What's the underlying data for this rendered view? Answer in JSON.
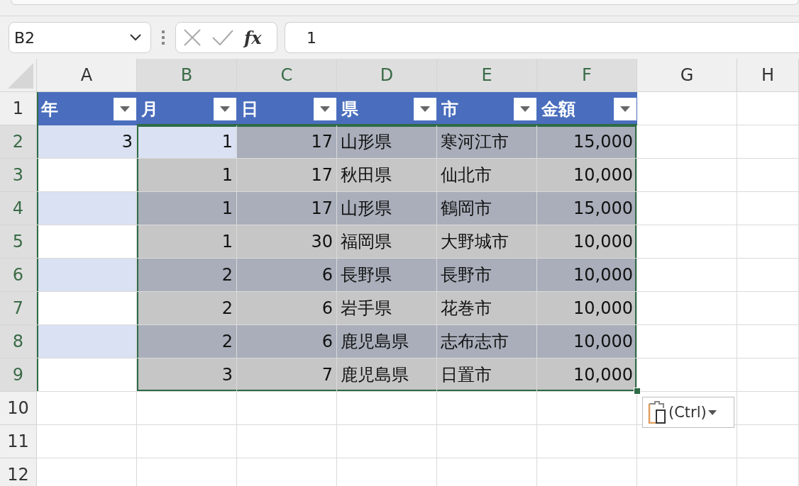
{
  "name_box": {
    "value": "B2"
  },
  "formula_bar": {
    "function_label": "fx",
    "value": "1"
  },
  "column_headers": [
    {
      "label": "A",
      "selected": false
    },
    {
      "label": "B",
      "selected": true
    },
    {
      "label": "C",
      "selected": true
    },
    {
      "label": "D",
      "selected": true
    },
    {
      "label": "E",
      "selected": true
    },
    {
      "label": "F",
      "selected": true
    },
    {
      "label": "G",
      "selected": false
    },
    {
      "label": "H",
      "selected": false
    }
  ],
  "row_headers": [
    {
      "label": "1",
      "selected": false
    },
    {
      "label": "2",
      "selected": true
    },
    {
      "label": "3",
      "selected": true
    },
    {
      "label": "4",
      "selected": true
    },
    {
      "label": "5",
      "selected": true
    },
    {
      "label": "6",
      "selected": true
    },
    {
      "label": "7",
      "selected": true
    },
    {
      "label": "8",
      "selected": true
    },
    {
      "label": "9",
      "selected": true
    },
    {
      "label": "10",
      "selected": false
    },
    {
      "label": "11",
      "selected": false
    },
    {
      "label": "12",
      "selected": false
    }
  ],
  "table": {
    "headers": [
      "年",
      "月",
      "日",
      "県",
      "市",
      "金額"
    ],
    "rows": [
      {
        "active": true,
        "year": "3",
        "month": "1",
        "day": "17",
        "prefecture": "山形県",
        "city": "寒河江市",
        "amount": "15,000"
      },
      {
        "active": false,
        "month": "1",
        "day": "17",
        "prefecture": "秋田県",
        "city": "仙北市",
        "amount": "10,000"
      },
      {
        "active": false,
        "month": "1",
        "day": "17",
        "prefecture": "山形県",
        "city": "鶴岡市",
        "amount": "15,000"
      },
      {
        "active": false,
        "month": "1",
        "day": "30",
        "prefecture": "福岡県",
        "city": "大野城市",
        "amount": "10,000"
      },
      {
        "active": false,
        "month": "2",
        "day": "6",
        "prefecture": "長野県",
        "city": "長野市",
        "amount": "10,000"
      },
      {
        "active": false,
        "month": "2",
        "day": "6",
        "prefecture": "岩手県",
        "city": "花巻市",
        "amount": "10,000"
      },
      {
        "active": false,
        "month": "2",
        "day": "6",
        "prefecture": "鹿児島県",
        "city": "志布志市",
        "amount": "10,000"
      },
      {
        "active": false,
        "month": "3",
        "day": "7",
        "prefecture": "鹿児島県",
        "city": "日置市",
        "amount": "10,000"
      }
    ]
  },
  "paste_options": {
    "label": "(Ctrl)"
  }
}
